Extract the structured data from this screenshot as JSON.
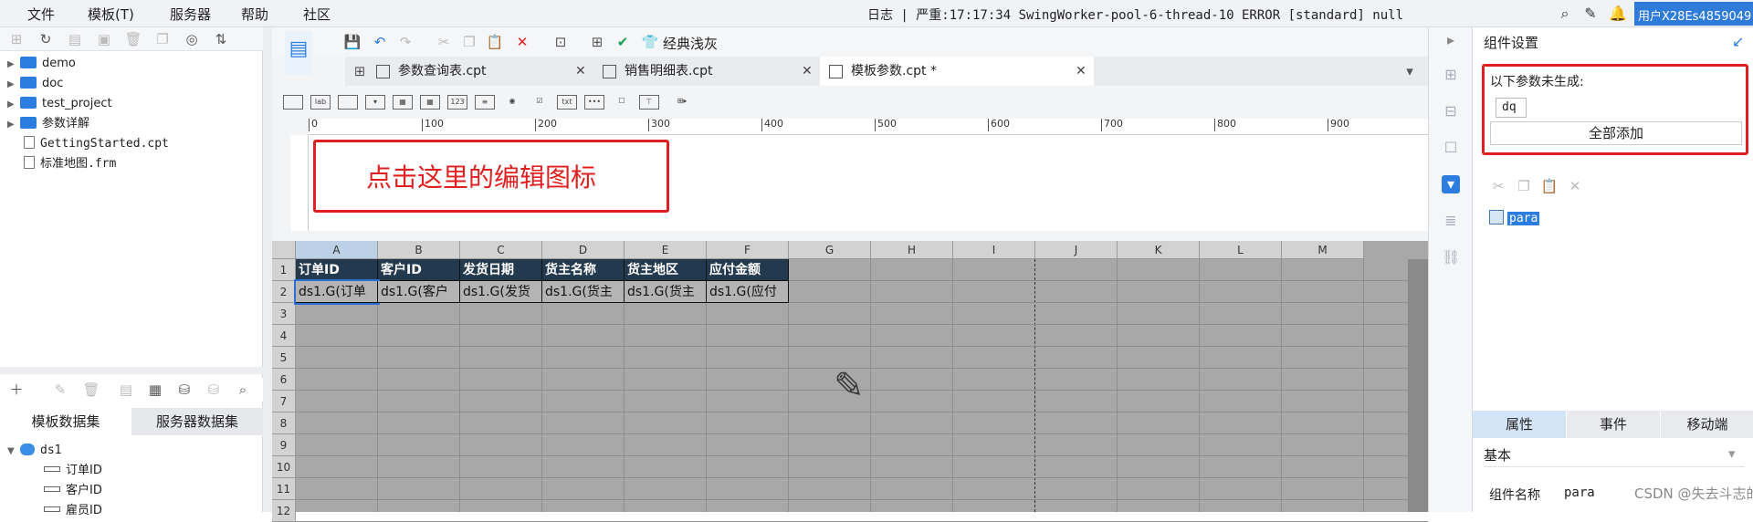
{
  "menubar": {
    "items": [
      "文件",
      "模板(T)",
      "服务器",
      "帮助",
      "社区"
    ],
    "status": "日志 | 严重:17:17:34 SwingWorker-pool-6-thread-10 ERROR [standard] null",
    "user": "用户X28Es4859049"
  },
  "file_tree": [
    {
      "label": "demo",
      "type": "folder"
    },
    {
      "label": "doc",
      "type": "folder"
    },
    {
      "label": "test_project",
      "type": "folder"
    },
    {
      "label": "参数详解",
      "type": "folder"
    },
    {
      "label": "GettingStarted.cpt",
      "type": "file"
    },
    {
      "label": "标准地图.frm",
      "type": "file"
    }
  ],
  "dataset_tabs": [
    "模板数据集",
    "服务器数据集"
  ],
  "dataset_tree": {
    "root": "ds1",
    "fields": [
      "订单ID",
      "客户ID",
      "雇员ID"
    ]
  },
  "toolbar": {
    "theme_label": "经典浅灰"
  },
  "doc_tabs": [
    {
      "label": "参数查询表.cpt",
      "active": false
    },
    {
      "label": "销售明细表.cpt",
      "active": false
    },
    {
      "label": "模板参数.cpt *",
      "active": true
    }
  ],
  "widget_icons": [
    "label",
    "lab",
    "textbox",
    "combo",
    "date",
    "grid",
    "number",
    "textarea",
    "radio",
    "checkbox",
    "txt",
    "password",
    "tree",
    "tree-combo",
    "more"
  ],
  "ruler_marks": [
    "0",
    "100",
    "200",
    "300",
    "400",
    "500",
    "600",
    "700",
    "800",
    "900"
  ],
  "annotation": "点击这里的编辑图标",
  "grid": {
    "columns": [
      "A",
      "B",
      "C",
      "D",
      "E",
      "F",
      "G",
      "H",
      "I",
      "J",
      "K",
      "L",
      "M"
    ],
    "rows": [
      "1",
      "2",
      "3",
      "4",
      "5",
      "6",
      "7",
      "8",
      "9",
      "10",
      "11",
      "12"
    ],
    "header_cells": [
      "订单ID",
      "客户ID",
      "发货日期",
      "货主名称",
      "货主地区",
      "应付金额"
    ],
    "value_cells": [
      "ds1.G(订单",
      "ds1.G(客户",
      "ds1.G(发货",
      "ds1.G(货主",
      "ds1.G(货主",
      "ds1.G(应付"
    ]
  },
  "right_panel": {
    "title": "组件设置",
    "missing_params_label": "以下参数未生成:",
    "param_chip": "dq",
    "add_all_label": "全部添加",
    "tree_node": "para",
    "tabs": [
      "属性",
      "事件",
      "移动端"
    ],
    "section_label": "基本",
    "field_label": "组件名称",
    "field_value": "para"
  },
  "watermark": "CSDN @失去斗志的菜鸟",
  "colors": {
    "accent": "#2b7de0",
    "annotation": "#e02020",
    "header_cell": "#233a4e"
  }
}
